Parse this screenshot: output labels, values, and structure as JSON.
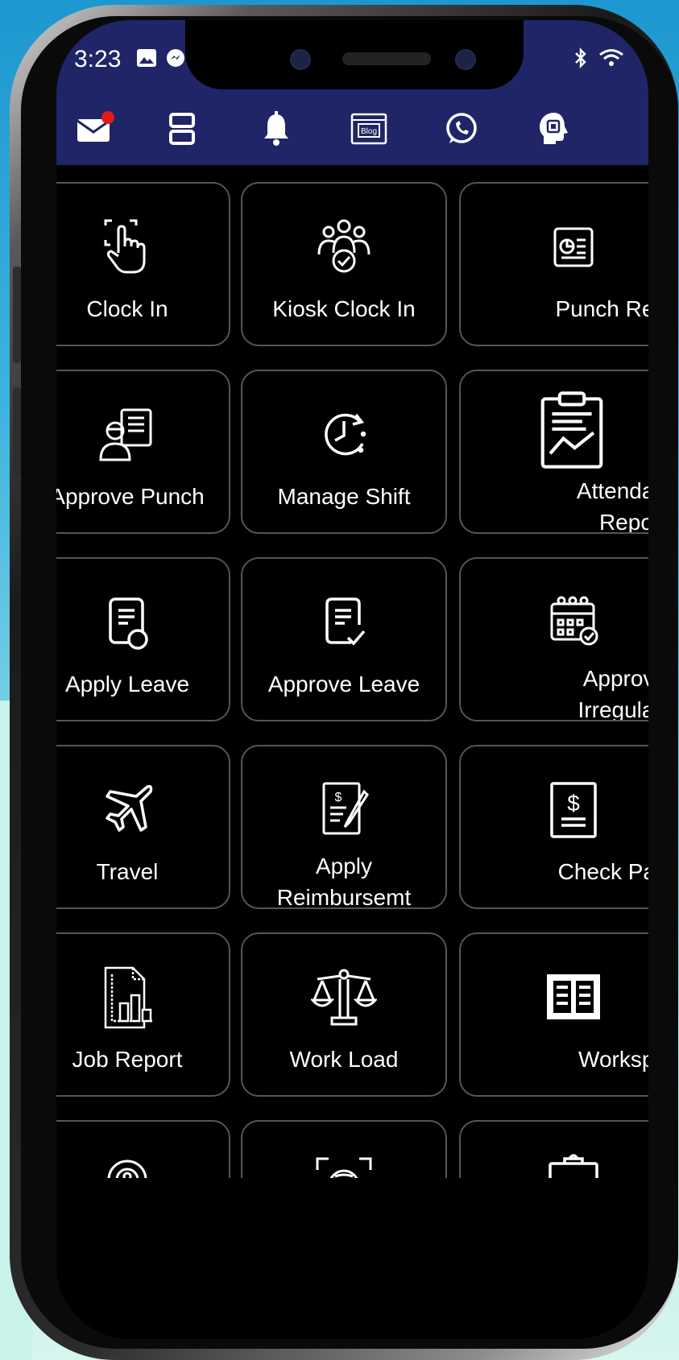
{
  "status_bar": {
    "time": "3:23",
    "icons": [
      "gallery-icon",
      "messenger-icon",
      "bluetooth-icon",
      "wifi-icon"
    ]
  },
  "toolbar": {
    "items": [
      {
        "name": "mail-icon",
        "badge": true,
        "badge_color": "#e01b1b"
      },
      {
        "name": "layout-icon"
      },
      {
        "name": "bell-icon"
      },
      {
        "name": "blog-icon",
        "label": "Blog"
      },
      {
        "name": "whatsapp-icon"
      },
      {
        "name": "ai-assistant-icon"
      }
    ]
  },
  "colors": {
    "header_bg": "#1f2566",
    "tile_bg": "#000000",
    "tile_border": "#555555",
    "text": "#ffffff"
  },
  "tiles": [
    {
      "icon": "tap-finger-icon",
      "label": "Clock In"
    },
    {
      "icon": "group-users-icon",
      "label": "Kiosk Clock In"
    },
    {
      "icon": "punch-report-icon",
      "label": "Punch Rep"
    },
    {
      "icon": "approve-punch-icon",
      "label": "Approve Punch"
    },
    {
      "icon": "clock-rotate-icon",
      "label": "Manage Shift"
    },
    {
      "icon": "attendance-report-icon",
      "label": "Attendan",
      "label2": "Report"
    },
    {
      "icon": "apply-leave-icon",
      "label": "Apply Leave"
    },
    {
      "icon": "approve-leave-icon",
      "label": "Approve Leave"
    },
    {
      "icon": "calendar-check-icon",
      "label": "Approve",
      "label2": "Irregulari"
    },
    {
      "icon": "airplane-icon",
      "label": "Travel"
    },
    {
      "icon": "reimbursement-icon",
      "label": "Apply",
      "label2": "Reimbursemt"
    },
    {
      "icon": "payslip-icon",
      "label": "Check Pay"
    },
    {
      "icon": "job-report-icon",
      "label": "Job Report"
    },
    {
      "icon": "scales-icon",
      "label": "Work Load"
    },
    {
      "icon": "workspace-icon",
      "label": "Workspa"
    },
    {
      "icon": "location-pin-icon",
      "label": ""
    },
    {
      "icon": "face-scan-icon",
      "label": ""
    },
    {
      "icon": "clipboard-check-icon",
      "label": ""
    }
  ]
}
